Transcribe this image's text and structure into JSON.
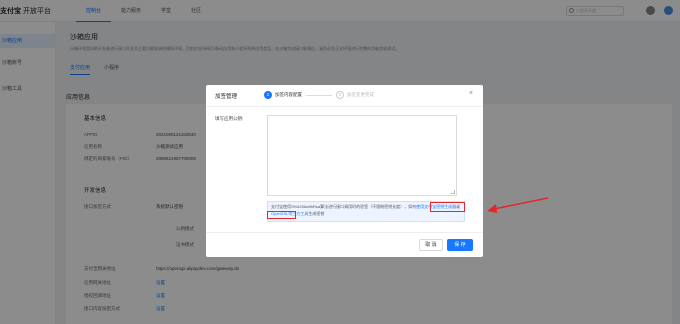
{
  "header": {
    "logo_text": "支付宝",
    "platform_name": "开放平台",
    "nav": [
      "控制台",
      "能力服务",
      "学堂",
      "社区"
    ],
    "search_placeholder": "小程序开放"
  },
  "sidebar": {
    "items": [
      {
        "label": "沙箱应用"
      },
      {
        "label": "沙箱账号"
      },
      {
        "label": "沙箱工具"
      }
    ]
  },
  "main": {
    "title": "沙箱应用",
    "description": "沙箱环境是协助开发者进行接口开发及主要功能联调的模拟环境，目前仅支持网页/移动应用和小程序两种应用类型。在沙箱完成接口联调后，请务必在正式环境进行完整的功能验收测试。",
    "tabs": [
      "支付应用",
      "小程序"
    ],
    "app_info_title": "应用信息",
    "basic_info_title": "基本信息",
    "rows": [
      {
        "label": "APPID",
        "value": "2021000121162540"
      },
      {
        "label": "应用名称",
        "value": "沙箱测试应用"
      },
      {
        "label": "绑定的商家账号（PID）",
        "value": "2088621907700000"
      }
    ],
    "dev_info_title": "开发信息",
    "sign_method_label": "接口加签方式",
    "sign_method_value": "系统默认密钥",
    "public_key_label": "公钥模式",
    "cert_mode_label": "证书模式",
    "gateway_label": "支付宝网关地址",
    "gateway_value": "https://openapi.alipaydev.com/gateway.do",
    "link_rows": [
      {
        "label": "应用网关地址",
        "value": "设置"
      },
      {
        "label": "授权回调地址",
        "value": "设置"
      },
      {
        "label": "接口内容加密方式",
        "value": "设置"
      }
    ]
  },
  "modal": {
    "title": "加签管理",
    "step1_number": "1",
    "step1_label": "加签内容配置",
    "step2_number": "2",
    "step2_label": "加签变更完成",
    "close_glyph": "×",
    "field_label": "填写应用公钥:",
    "textarea_value": "",
    "info_prefix": "支付宝使用SHA256withRsa算法进行接口调用时的验签（不限制密钥长度），如何",
    "info_link1": "使用支付宝",
    "info_link2": "密钥生成器",
    "info_mid": "或",
    "info_link3": "OpenSSL等三方工具",
    "info_suffix": "生成密钥",
    "cancel_label": "取 消",
    "save_label": "保 存"
  },
  "colors": {
    "primary": "#1677ff",
    "highlight": "#e0282e"
  }
}
